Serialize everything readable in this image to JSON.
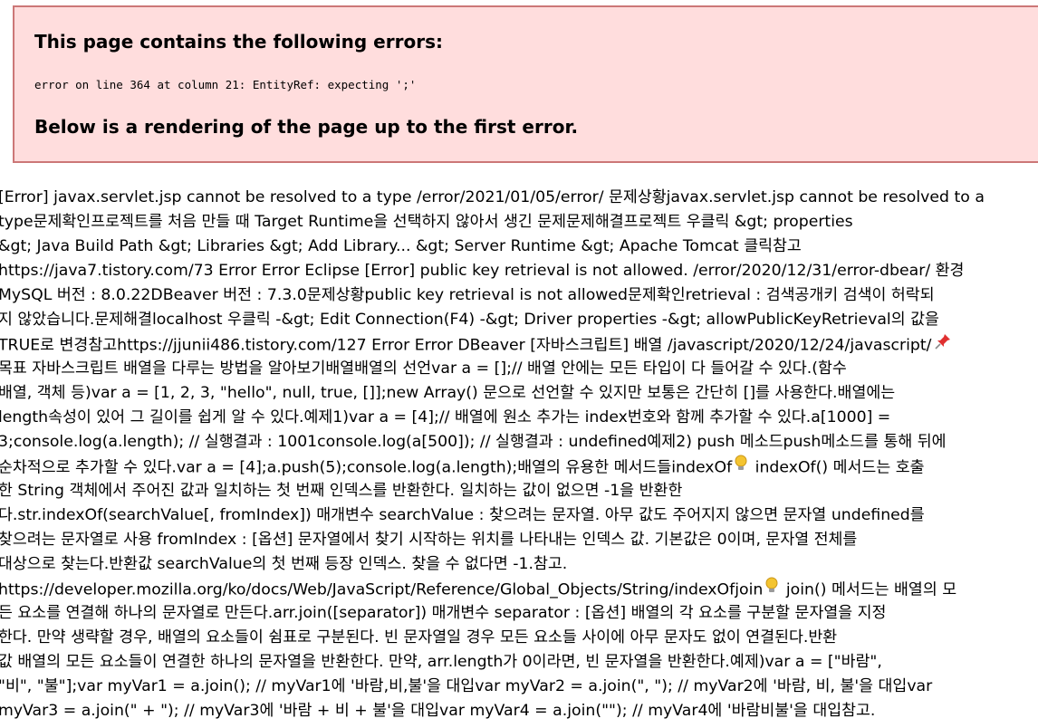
{
  "error_box": {
    "heading": "This page contains the following errors:",
    "detail": "error on line 364 at column 21: EntityRef: expecting ';'",
    "footer": "Below is a rendering of the page up to the first error."
  },
  "content_lines": [
    "[Error] javax.servlet.jsp cannot be resolved to a type /error/2021/01/05/error/ 문제상황javax.servlet.jsp cannot be resolved to a",
    "type문제확인프로젝트를 처음 만들 때 Target Runtime을 선택하지 않아서 생긴 문제문제해결프로젝트 우클릭 &gt; properties",
    "&gt; Java Build Path &gt; Libraries &gt; Add Library... &gt; Server Runtime &gt; Apache Tomcat 클릭참고",
    "https://java7.tistory.com/73 Error Error Eclipse [Error] public key retrieval is not allowed. /error/2020/12/31/error-dbear/ 환경",
    "MySQL 버전 : 8.0.22DBeaver 버전 : 7.3.0문제상황public key retrieval is not allowed문제확인retrieval : 검색공개키 검색이 허락되",
    "지 않았습니다.문제해결localhost 우클릭 -&gt; Edit Connection(F4) -&gt; Driver properties -&gt; allowPublicKeyRetrieval의 값을",
    "TRUE로 변경참고https://jjunii486.tistory.com/127 Error Error DBeaver [자바스크립트] 배열 /javascript/2020/12/24/javascript/",
    "목표 자바스크립트 배열을 다루는 방법을 알아보기배열배열의 선언var a = [];// 배열 안에는 모든 타입이 다 들어갈 수 있다.(함수",
    "배열, 객체 등)var a = [1, 2, 3, \"hello\", null, true, []];new Array() 문으로 선언할 수 있지만 보통은 간단히 []를 사용한다.배열에는",
    "length속성이 있어 그 길이를 쉽게 알 수 있다.예제1)var a = [4];// 배열에 원소 추가는 index번호와 함께 추가할 수 있다.a[1000] =",
    "3;console.log(a.length); // 실행결과 : 1001console.log(a[500]); // 실행결과 : undefined예제2) push 메소드push메소드를 통해 뒤에",
    "순차적으로 추가할 수 있다.var a = [4];a.push(5);console.log(a.length);배열의 유용한 메서드들indexOf",
    "한 String 객체에서 주어진 값과 일치하는 첫 번째 인덱스를 반환한다. 일치하는 값이 없으면 -1을 반환한",
    "다.str.indexOf(searchValue[, fromIndex]) 매개변수 searchValue : 찾으려는 문자열. 아무 값도 주어지지 않으면 문자열 undefined를",
    "찾으려는 문자열로 사용 fromIndex : [옵션] 문자열에서 찾기 시작하는 위치를 나타내는 인덱스 값. 기본값은 0이며, 문자열 전체를",
    "대상으로 찾는다.반환값 searchValue의 첫 번째 등장 인덱스. 찾을 수 없다면 -1.참고.",
    "https://developer.mozilla.org/ko/docs/Web/JavaScript/Reference/Global_Objects/String/indexOfjoin",
    "든 요소를 연결해 하나의 문자열로 만든다.arr.join([separator]) 매개변수 separator : [옵션] 배열의 각 요소를 구분할 문자열을 지정",
    "한다. 만약 생략할 경우, 배열의 요소들이 쉼표로 구분된다. 빈 문자열일 경우 모든 요소들 사이에 아무 문자도 없이 연결된다.반환",
    "값 배열의 모든 요소들이 연결한 하나의 문자열을 반환한다. 만약, arr.length가 0이라면, 빈 문자열을 반환한다.예제)var a = [\"바람\",",
    "\"비\", \"불\"];var myVar1 = a.join(); // myVar1에 '바람,비,불'을 대입var myVar2 = a.join(\", \"); // myVar2에 '바람, 비, 불'을 대입var",
    "myVar3 = a.join(\" + \"); // myVar3에 '바람 + 비 + 불'을 대입var myVar4 = a.join(\"\"); // myVar4에 '바람비불'을 대입참고."
  ],
  "inline_suffixes": {
    "line_11": " indexOf() 메서드는 호출",
    "line_16": " join() 메서드는 배열의 모"
  },
  "icons": {
    "pin": "pushpin-icon",
    "bulb": "lightbulb-icon"
  },
  "colors": {
    "error_bg": "#ffdddd",
    "error_border": "#cc7777",
    "pin": "#e03030",
    "bulb": "#f4c430"
  }
}
